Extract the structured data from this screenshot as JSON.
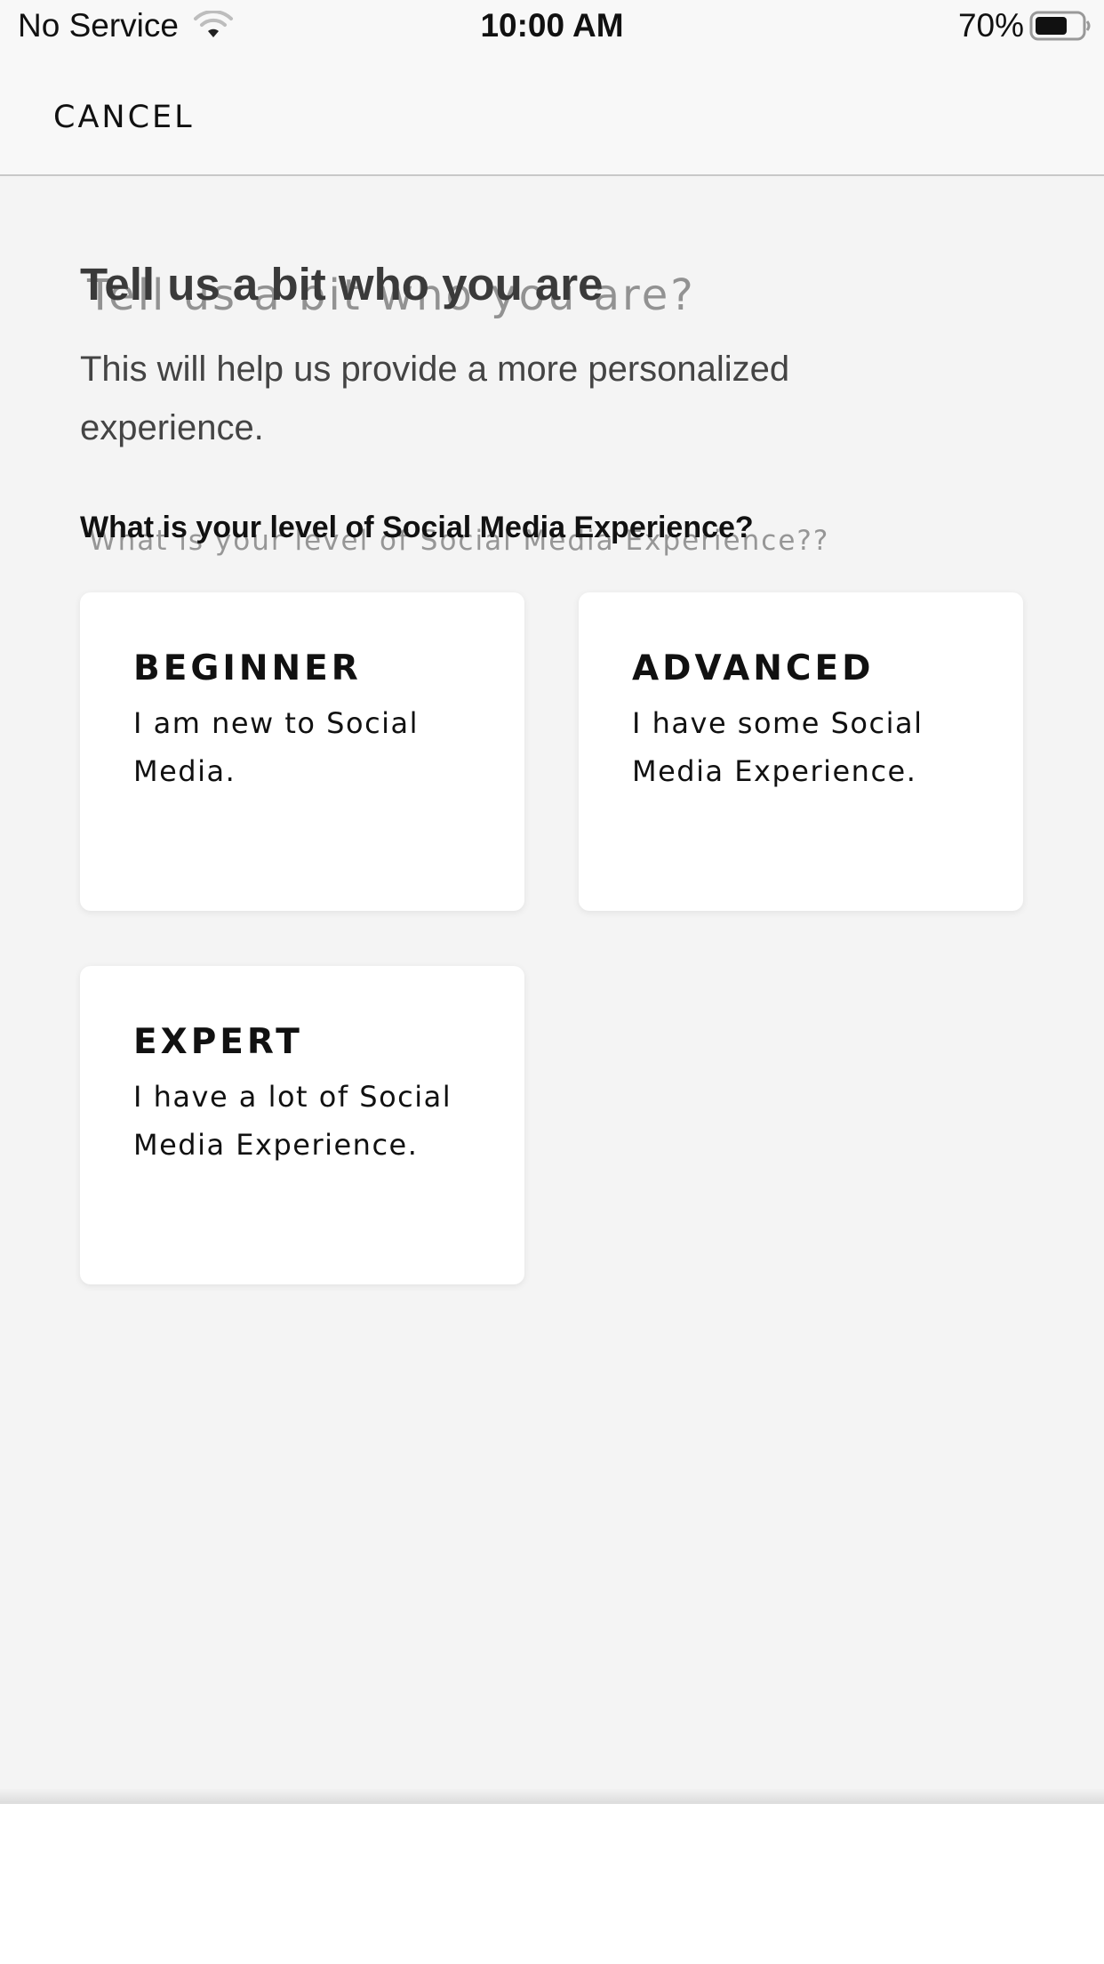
{
  "status_bar": {
    "carrier": "No Service",
    "time": "10:00 AM",
    "battery_percent": "70%",
    "battery_level": 0.7,
    "wifi_icon": "wifi-icon",
    "battery_icon": "battery-icon"
  },
  "top_bar": {
    "cancel_label": "CANCEL"
  },
  "content": {
    "heading": "Tell us a bit who you are",
    "heading_ghost": "Tell us a bit who you are?",
    "subtitle": "This will help us provide a more personalized experience.",
    "question": "What is your level of Social Media Experience?",
    "question_ghost": "What is your level of Social Media Experience??"
  },
  "options": [
    {
      "title": "BEGINNER",
      "description": "I am new to Social Media."
    },
    {
      "title": "ADVANCED",
      "description": "I have some Social Media Experience."
    },
    {
      "title": "EXPERT",
      "description": "I have a lot of Social Media Experience."
    }
  ],
  "colors": {
    "background": "#f4f4f4",
    "bar_background": "#f8f8f8",
    "card_background": "#ffffff",
    "text": "#111111"
  }
}
